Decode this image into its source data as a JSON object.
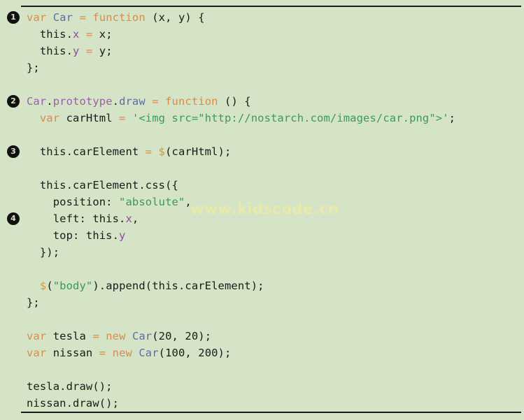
{
  "listing": {
    "language": "javascript",
    "background_color": "#d5e3c6",
    "rule_color": "#1a1a1a",
    "watermark": "www.kidscode.cn",
    "watermark_color": "#e9e9a8",
    "bullets": [
      "❶",
      "❷",
      "❸",
      "❹"
    ],
    "bullet_numbers": [
      "1",
      "2",
      "3",
      "4"
    ],
    "lines": [
      {
        "bullet": "1",
        "text": "var Car = function (x, y) {",
        "tokens": [
          {
            "t": "var",
            "c": "kw"
          },
          {
            "t": " ",
            "c": "plain"
          },
          {
            "t": "Car",
            "c": "cls"
          },
          {
            "t": " ",
            "c": "plain"
          },
          {
            "t": "=",
            "c": "op"
          },
          {
            "t": " ",
            "c": "plain"
          },
          {
            "t": "function",
            "c": "kw"
          },
          {
            "t": " (x, y) {",
            "c": "plain"
          }
        ]
      },
      {
        "bullet": "",
        "text": "  this.x = x;",
        "tokens": [
          {
            "t": "  this.",
            "c": "plain"
          },
          {
            "t": "x",
            "c": "attr"
          },
          {
            "t": " ",
            "c": "plain"
          },
          {
            "t": "=",
            "c": "op"
          },
          {
            "t": " x;",
            "c": "plain"
          }
        ]
      },
      {
        "bullet": "",
        "text": "  this.y = y;",
        "tokens": [
          {
            "t": "  this.",
            "c": "plain"
          },
          {
            "t": "y",
            "c": "attr"
          },
          {
            "t": " ",
            "c": "plain"
          },
          {
            "t": "=",
            "c": "op"
          },
          {
            "t": " y;",
            "c": "plain"
          }
        ]
      },
      {
        "bullet": "",
        "text": "};",
        "tokens": [
          {
            "t": "};",
            "c": "plain"
          }
        ]
      },
      {
        "bullet": "",
        "text": "",
        "tokens": []
      },
      {
        "bullet": "2",
        "text": "Car.prototype.draw = function () {",
        "tokens": [
          {
            "t": "Car",
            "c": "prop"
          },
          {
            "t": ".",
            "c": "plain"
          },
          {
            "t": "prototype",
            "c": "prop"
          },
          {
            "t": ".",
            "c": "plain"
          },
          {
            "t": "draw",
            "c": "meth"
          },
          {
            "t": " ",
            "c": "plain"
          },
          {
            "t": "=",
            "c": "op"
          },
          {
            "t": " ",
            "c": "plain"
          },
          {
            "t": "function",
            "c": "kw"
          },
          {
            "t": " () {",
            "c": "plain"
          }
        ]
      },
      {
        "bullet": "",
        "text": "  var carHtml = '<img src=\"http://nostarch.com/images/car.png\">';",
        "tokens": [
          {
            "t": "  ",
            "c": "plain"
          },
          {
            "t": "var",
            "c": "kw"
          },
          {
            "t": " carHtml ",
            "c": "plain"
          },
          {
            "t": "=",
            "c": "op"
          },
          {
            "t": " ",
            "c": "plain"
          },
          {
            "t": "'<img src=\"http://nostarch.com/images/car.png\">'",
            "c": "str"
          },
          {
            "t": ";",
            "c": "plain"
          }
        ]
      },
      {
        "bullet": "",
        "text": "",
        "tokens": []
      },
      {
        "bullet": "3",
        "text": "  this.carElement = $(carHtml);",
        "tokens": [
          {
            "t": "  this.carElement ",
            "c": "plain"
          },
          {
            "t": "=",
            "c": "op"
          },
          {
            "t": " ",
            "c": "plain"
          },
          {
            "t": "$",
            "c": "dollar"
          },
          {
            "t": "(carHtml);",
            "c": "plain"
          }
        ]
      },
      {
        "bullet": "",
        "text": "",
        "tokens": []
      },
      {
        "bullet": "",
        "text": "  this.carElement.css({",
        "tokens": [
          {
            "t": "  this.carElement.css({",
            "c": "plain"
          }
        ]
      },
      {
        "bullet": "",
        "text": "    position: \"absolute\",",
        "tokens": [
          {
            "t": "    position: ",
            "c": "plain"
          },
          {
            "t": "\"absolute\"",
            "c": "str"
          },
          {
            "t": ",",
            "c": "plain"
          }
        ]
      },
      {
        "bullet": "4",
        "text": "    left: this.x,",
        "tokens": [
          {
            "t": "    left: this.",
            "c": "plain"
          },
          {
            "t": "x",
            "c": "attr"
          },
          {
            "t": ",",
            "c": "plain"
          }
        ]
      },
      {
        "bullet": "",
        "text": "    top: this.y",
        "tokens": [
          {
            "t": "    top: this.",
            "c": "plain"
          },
          {
            "t": "y",
            "c": "attr"
          }
        ]
      },
      {
        "bullet": "",
        "text": "  });",
        "tokens": [
          {
            "t": "  });",
            "c": "plain"
          }
        ]
      },
      {
        "bullet": "",
        "text": "",
        "tokens": []
      },
      {
        "bullet": "",
        "text": "  $(\"body\").append(this.carElement);",
        "tokens": [
          {
            "t": "  ",
            "c": "plain"
          },
          {
            "t": "$",
            "c": "dollar"
          },
          {
            "t": "(",
            "c": "plain"
          },
          {
            "t": "\"body\"",
            "c": "str"
          },
          {
            "t": ").append(this.carElement);",
            "c": "plain"
          }
        ]
      },
      {
        "bullet": "",
        "text": "};",
        "tokens": [
          {
            "t": "};",
            "c": "plain"
          }
        ]
      },
      {
        "bullet": "",
        "text": "",
        "tokens": []
      },
      {
        "bullet": "",
        "text": "var tesla = new Car(20, 20);",
        "tokens": [
          {
            "t": "var",
            "c": "kw"
          },
          {
            "t": " tesla ",
            "c": "plain"
          },
          {
            "t": "=",
            "c": "op"
          },
          {
            "t": " ",
            "c": "plain"
          },
          {
            "t": "new",
            "c": "kw"
          },
          {
            "t": " ",
            "c": "plain"
          },
          {
            "t": "Car",
            "c": "cls"
          },
          {
            "t": "(20, 20);",
            "c": "plain"
          }
        ]
      },
      {
        "bullet": "",
        "text": "var nissan = new Car(100, 200);",
        "tokens": [
          {
            "t": "var",
            "c": "kw"
          },
          {
            "t": " nissan ",
            "c": "plain"
          },
          {
            "t": "=",
            "c": "op"
          },
          {
            "t": " ",
            "c": "plain"
          },
          {
            "t": "new",
            "c": "kw"
          },
          {
            "t": " ",
            "c": "plain"
          },
          {
            "t": "Car",
            "c": "cls"
          },
          {
            "t": "(100, 200);",
            "c": "plain"
          }
        ]
      },
      {
        "bullet": "",
        "text": "",
        "tokens": []
      },
      {
        "bullet": "",
        "text": "tesla.draw();",
        "tokens": [
          {
            "t": "tesla.draw();",
            "c": "plain"
          }
        ]
      },
      {
        "bullet": "",
        "text": "nissan.draw();",
        "tokens": [
          {
            "t": "nissan.draw();",
            "c": "plain"
          }
        ]
      }
    ]
  }
}
